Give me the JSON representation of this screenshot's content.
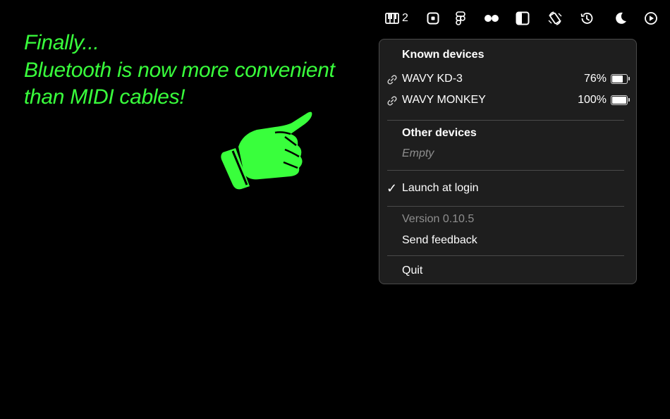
{
  "menubar": {
    "items": [
      {
        "icon": "piano-keyboard-icon",
        "count": "2"
      },
      {
        "icon": "square-dot-icon"
      },
      {
        "icon": "figma-icon"
      },
      {
        "icon": "flickr-dots-icon"
      },
      {
        "icon": "sidebar-panel-icon"
      },
      {
        "icon": "rotate-device-icon"
      },
      {
        "icon": "history-clock-icon"
      },
      {
        "icon": "moon-icon"
      },
      {
        "icon": "play-circle-icon"
      }
    ]
  },
  "promo": {
    "line1": "Finally...",
    "line2": "Bluetooth is now more convenient",
    "line3": "than MIDI cables!",
    "color": "#39ff3c",
    "pointer_icon": "pointing-hand-icon"
  },
  "menu": {
    "known_header": "Known devices",
    "known_devices": [
      {
        "name": "WAVY KD-3",
        "battery_label": "76%",
        "battery_level": 0.76,
        "icon": "link-icon"
      },
      {
        "name": "WAVY MONKEY",
        "battery_label": "100%",
        "battery_level": 1.0,
        "icon": "link-icon"
      }
    ],
    "other_header": "Other devices",
    "other_empty": "Empty",
    "launch_at_login": "Launch at login",
    "launch_checked": true,
    "check_glyph": "✓",
    "version": "Version 0.10.5",
    "send_feedback": "Send feedback",
    "quit": "Quit"
  }
}
